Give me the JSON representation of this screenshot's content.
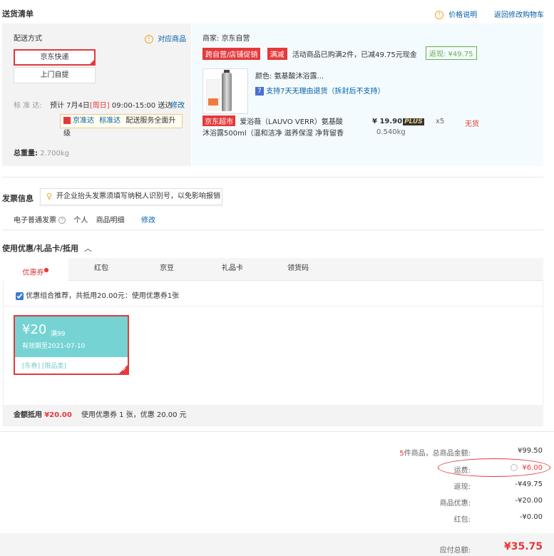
{
  "header": {
    "title": "送货清单",
    "price_info": "价格说明",
    "back_to_cart": "返回修改购物车"
  },
  "delivery": {
    "label": "配送方式",
    "match_goods": "对应商品",
    "options": [
      "京东快递",
      "上门自提"
    ],
    "eta_label": "标 准 达:",
    "eta_text": "预计 7月4日",
    "eta_day": "[周日]",
    "eta_time": "09:00-15:00 送达",
    "modify": "修改",
    "jd_fast": "京准达",
    "std_fast": "标准达",
    "upgrade": "配送服务全面升级",
    "weight_label": "总重量:",
    "weight_value": "2.700kg"
  },
  "merchant": {
    "label": "商家:",
    "name": "京东自营",
    "promo_tag": "跨自营/店铺促销",
    "promo_tag2": "满减",
    "promo_text": "活动商品已购满2件，已减49.75元现金",
    "cashback": "返现: ¥49.75"
  },
  "product": {
    "color_label": "颜色:",
    "color_value": "氨基酸沐浴露...",
    "return_icon": "7",
    "return_text": "支持7天无理由退货（拆封后不支持）",
    "store_tag": "京东超市",
    "name_line1": "爱浴薇（LAUVO VERR）氨基酸",
    "name_line2": "沐浴露500ml（温和洁净 滋养保湿 净背留香",
    "price": "¥ 19.90",
    "plus": "PLUS",
    "qty": "x5",
    "stock": "无货",
    "weight": "0.540kg"
  },
  "invoice": {
    "title": "发票信息",
    "tip": "开企业抬头发票须填写纳税人识别号，以免影响报销",
    "type": "电子普通发票",
    "personal": "个人",
    "detail": "商品明细",
    "modify": "修改"
  },
  "coupons": {
    "title": "使用优惠/礼品卡/抵用",
    "tabs": [
      "优惠券",
      "红包",
      "京豆",
      "礼品卡",
      "领货码"
    ],
    "combo_text": "优惠组合推荐，共抵用20.00元：使用优惠券1张",
    "coupon": {
      "amount": "¥20",
      "condition": "满99",
      "expiry": "有效期至2021-07-10",
      "tags": "[东券] [限品类]"
    },
    "total_label": "金额抵用",
    "total_value": "¥20.00",
    "total_desc": "使用优惠券 1 张，优惠 20.00 元"
  },
  "summary": {
    "count": "5",
    "count_suffix": "件商品，总商品金额:",
    "goods_total": "¥99.50",
    "shipping_label": "运费:",
    "shipping_value": "¥6.00",
    "cashback_label": "返现:",
    "cashback_value": "-¥49.75",
    "discount_label": "商品优惠:",
    "discount_value": "-¥20.00",
    "redpack_label": "红包:",
    "redpack_value": "-¥0.00",
    "pay_label": "应付总额:",
    "pay_value": "¥35.75"
  }
}
